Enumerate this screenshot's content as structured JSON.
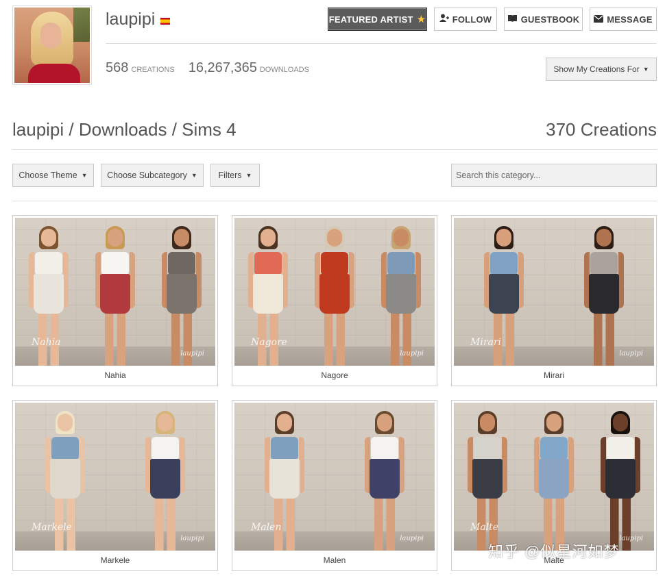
{
  "profile": {
    "username": "laupipi",
    "creations_count": "568",
    "creations_label": "Creations",
    "downloads_count": "16,267,365",
    "downloads_label": "Downloads"
  },
  "header_buttons": {
    "featured": "FEATURED ARTIST",
    "follow": "FOLLOW",
    "guestbook": "GUESTBOOK",
    "message": "MESSAGE",
    "show_creations": "Show My Creations For"
  },
  "breadcrumb": "laupipi / Downloads / Sims 4",
  "results_count": "370 Creations",
  "filters": {
    "theme": "Choose Theme",
    "subcategory": "Choose Subcategory",
    "filters": "Filters",
    "search_placeholder": "Search this category..."
  },
  "items": [
    {
      "title": "Nahia",
      "watermark": "Nahia",
      "brand": "laupipi"
    },
    {
      "title": "Nagore",
      "watermark": "Nagore",
      "brand": "laupipi"
    },
    {
      "title": "Mirari",
      "watermark": "Mirari",
      "brand": "laupipi"
    },
    {
      "title": "Markele",
      "watermark": "Markele",
      "brand": "laupipi"
    },
    {
      "title": "Malen",
      "watermark": "Malen",
      "brand": "laupipi"
    },
    {
      "title": "Malte",
      "watermark": "Malte",
      "brand": "laupipi"
    }
  ],
  "overlay_watermark": "知乎 @似星河如梦",
  "colors": {
    "featured_bg": "#5b5b5b",
    "star": "#ffc83d",
    "border": "#c8c8c8",
    "button_bg": "#f1f1f1"
  },
  "icons": {
    "featured": "star-icon",
    "follow": "user-plus-icon",
    "guestbook": "book-icon",
    "message": "envelope-icon",
    "dropdown": "caret-down-icon"
  }
}
